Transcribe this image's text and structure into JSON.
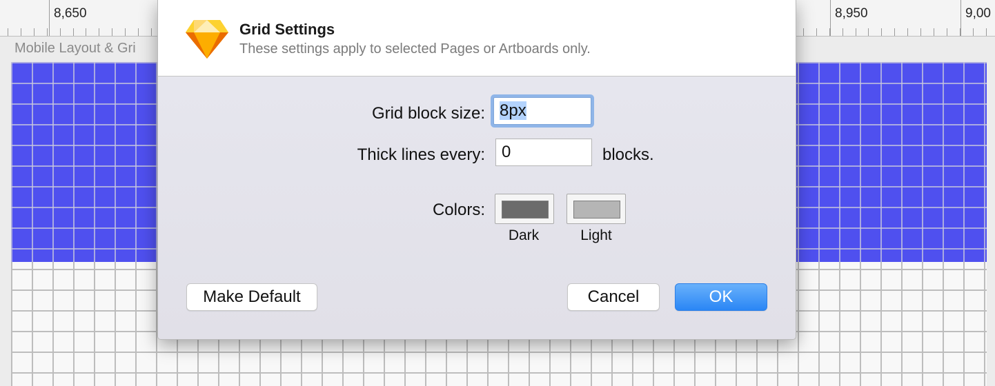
{
  "ruler": {
    "labels": [
      "8,650",
      "8,950",
      "9,00"
    ]
  },
  "canvas": {
    "artboard_label": "Mobile Layout & Gri",
    "header_color": "#4f50ef"
  },
  "dialog": {
    "app_icon": "sketch-diamond-icon",
    "title": "Grid Settings",
    "subtitle": "These settings apply to selected Pages or Artboards only.",
    "block_size_label": "Grid block size:",
    "block_size_value": "8px",
    "thick_lines_label": "Thick lines every:",
    "thick_lines_value": "0",
    "thick_lines_unit": "blocks.",
    "colors_label": "Colors:",
    "colors": [
      {
        "label": "Dark",
        "color": "#6b6b6b"
      },
      {
        "label": "Light",
        "color": "#b5b5b5"
      }
    ],
    "buttons": {
      "make_default": "Make Default",
      "cancel": "Cancel",
      "ok": "OK"
    },
    "accent_color": "#2a86f5"
  }
}
